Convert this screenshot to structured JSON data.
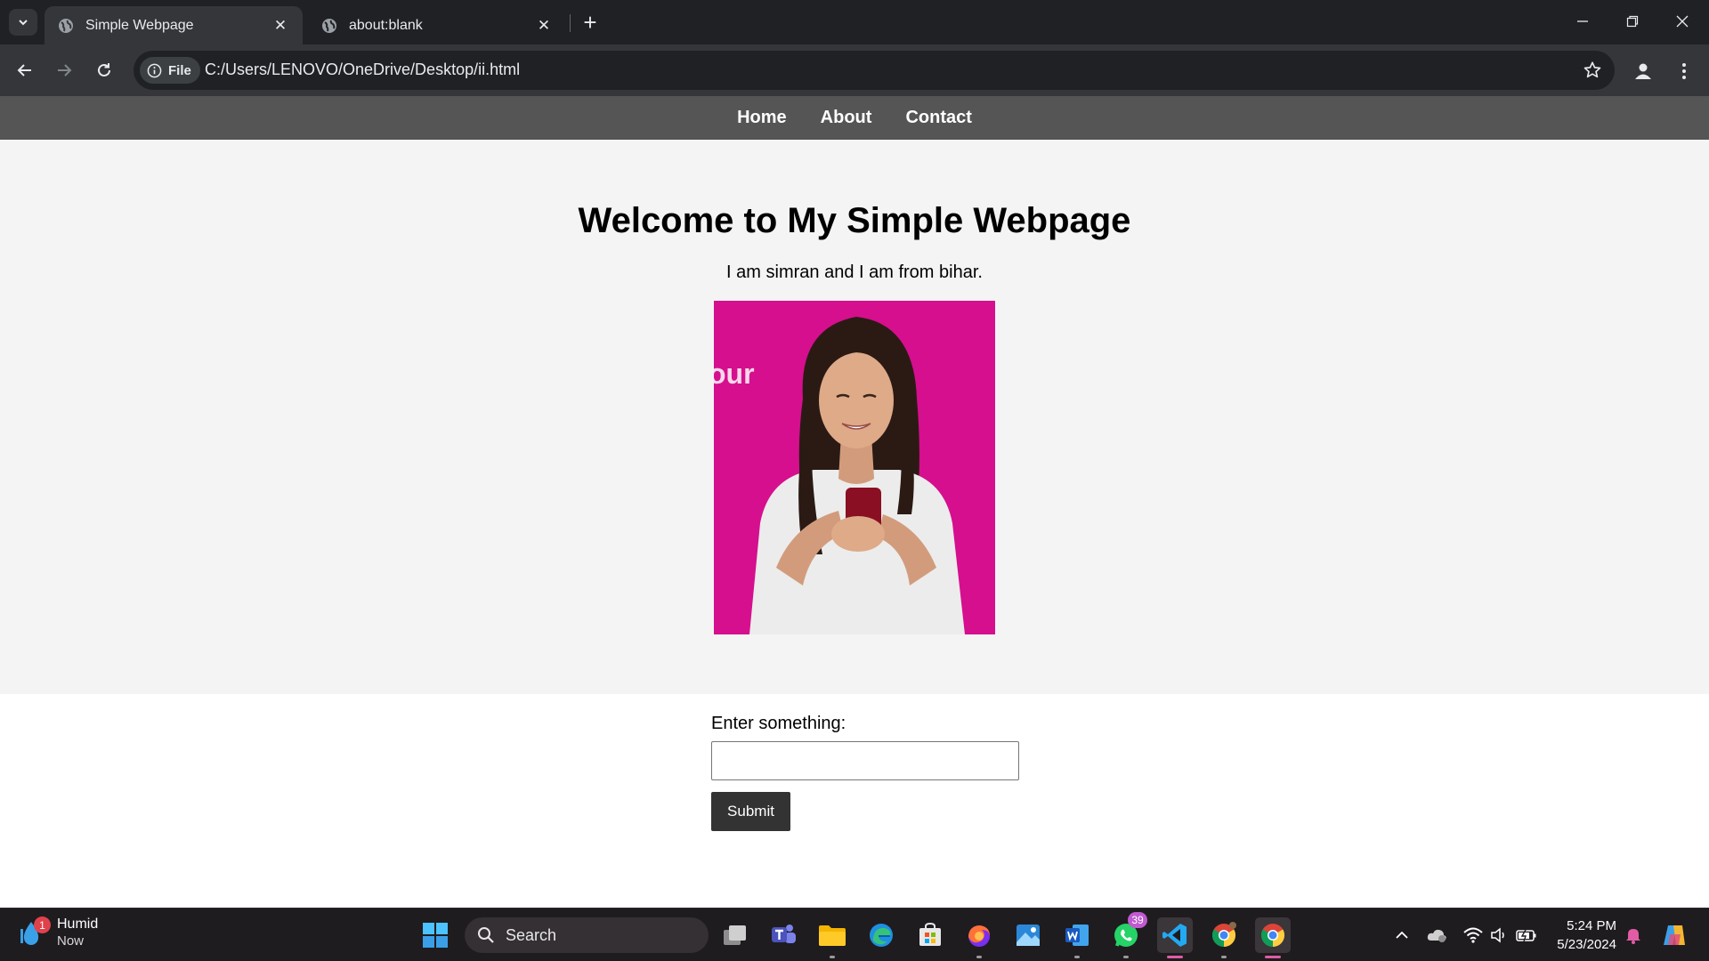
{
  "browser": {
    "tabs": [
      {
        "title": "Simple Webpage",
        "active": true
      },
      {
        "title": "about:blank",
        "active": false
      }
    ],
    "site_info_label": "File",
    "url": "C:/Users/LENOVO/OneDrive/Desktop/ii.html"
  },
  "page": {
    "nav": [
      "Home",
      "About",
      "Contact"
    ],
    "heading": "Welcome to My Simple Webpage",
    "intro": "I am simran and I am from bihar.",
    "photo_promo_text": "our",
    "form": {
      "label": "Enter something:",
      "input_value": "",
      "submit_label": "Submit"
    }
  },
  "taskbar": {
    "weather": {
      "badge": "1",
      "title": "Humid",
      "subtitle": "Now"
    },
    "search_label": "Search",
    "whatsapp_badge": "39",
    "time": "5:24 PM",
    "date": "5/23/2024"
  },
  "colors": {
    "site_nav_bg": "#555555",
    "hero_bg": "#f4f4f4",
    "photo_bg": "#d50f8e",
    "submit_bg": "#333333"
  }
}
